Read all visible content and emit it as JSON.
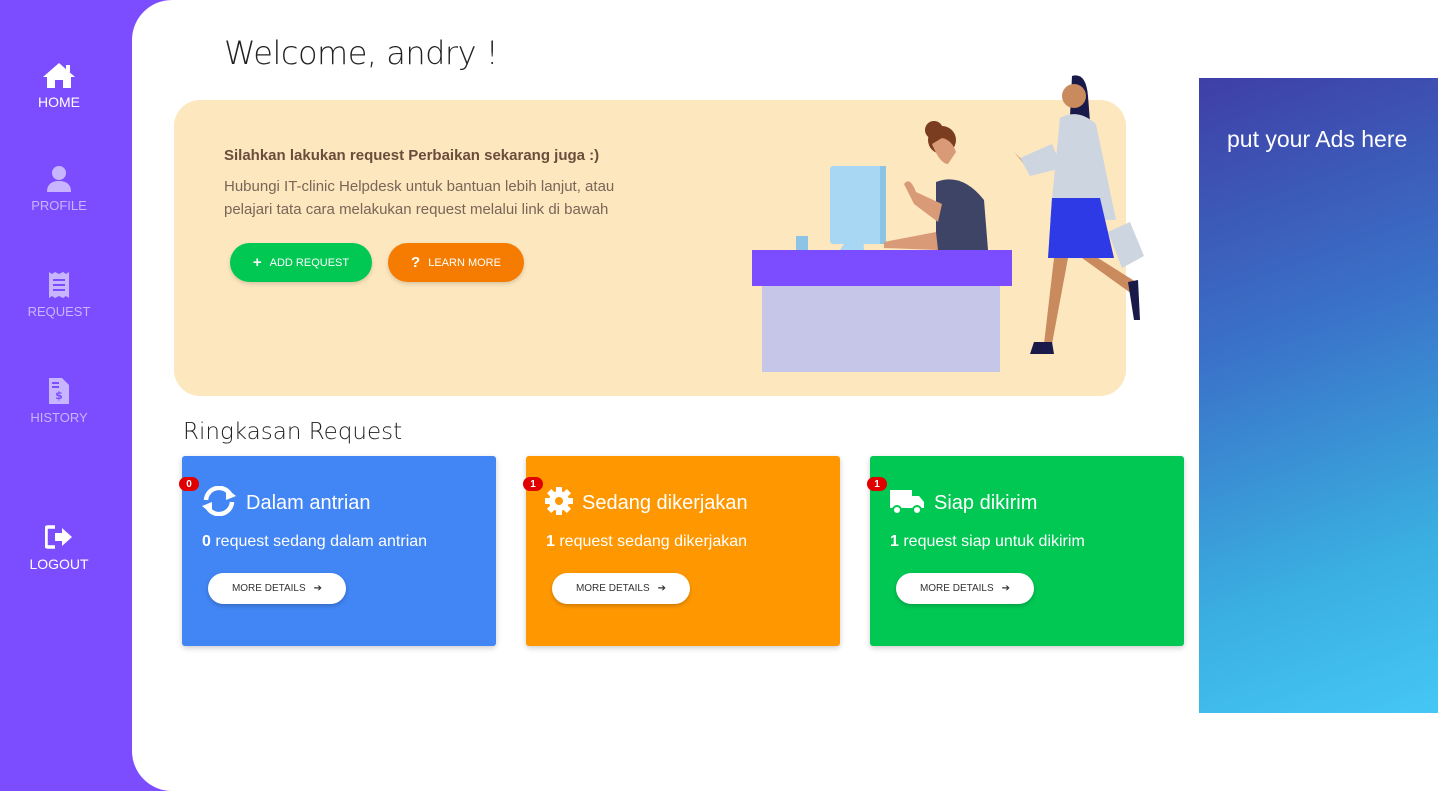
{
  "sidebar": {
    "items": [
      {
        "label": "HOME",
        "icon": "home-icon"
      },
      {
        "label": "PROFILE",
        "icon": "user-icon"
      },
      {
        "label": "REQUEST",
        "icon": "receipt-icon"
      },
      {
        "label": "HISTORY",
        "icon": "invoice-dollar-icon"
      },
      {
        "label": "LOGOUT",
        "icon": "sign-out-icon"
      }
    ]
  },
  "header": {
    "welcome": "Welcome, andry !"
  },
  "hero": {
    "title": "Silahkan lakukan request Perbaikan sekarang juga :)",
    "description": "Hubungi IT-clinic Helpdesk untuk bantuan lebih lanjut, atau pelajari tata cara melakukan request melalui link di bawah",
    "add_label": "ADD REQUEST",
    "learn_label": "LEARN MORE"
  },
  "summary": {
    "title": "Ringkasan Request",
    "cards": [
      {
        "badge": "0",
        "title": "Dalam antrian",
        "count": "0",
        "text": " request sedang dalam antrian",
        "more": "MORE DETAILS",
        "icon": "sync-icon",
        "color": "#4285f4"
      },
      {
        "badge": "1",
        "title": "Sedang dikerjakan",
        "count": "1",
        "text": " request sedang dikerjakan",
        "more": "MORE DETAILS",
        "icon": "gear-icon",
        "color": "#ff9800"
      },
      {
        "badge": "1",
        "title": "Siap dikirim",
        "count": "1",
        "text": " request siap untuk dikirim",
        "more": "MORE DETAILS",
        "icon": "truck-icon",
        "color": "#00c853"
      }
    ]
  },
  "ads": {
    "text": "put your Ads here"
  },
  "colors": {
    "sidebar": "#7c4dff",
    "hero_bg": "#fde7bf",
    "add": "#00c853",
    "learn": "#f57c00"
  }
}
